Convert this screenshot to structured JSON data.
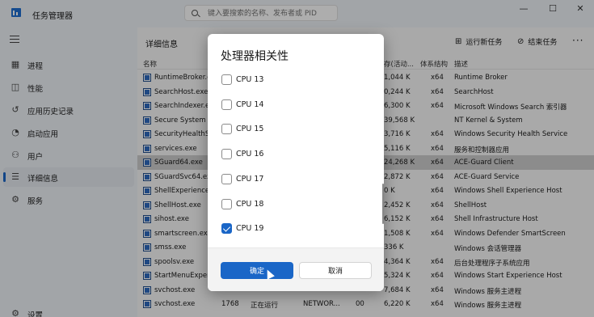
{
  "window": {
    "title": "任务管理器"
  },
  "search": {
    "placeholder": "键入要搜索的名称、发布者或 PID"
  },
  "controls": {
    "minimize": "—",
    "maximize": "☐",
    "close": "✕"
  },
  "sidebar": {
    "items": [
      {
        "label": "进程",
        "icon": "processes-icon"
      },
      {
        "label": "性能",
        "icon": "performance-icon"
      },
      {
        "label": "应用历史记录",
        "icon": "history-icon"
      },
      {
        "label": "启动应用",
        "icon": "startup-icon"
      },
      {
        "label": "用户",
        "icon": "users-icon"
      },
      {
        "label": "详细信息",
        "icon": "details-icon",
        "active": true
      },
      {
        "label": "服务",
        "icon": "services-icon"
      }
    ],
    "settings": "设置"
  },
  "toolbar": {
    "page_title": "详细信息",
    "run_new_task": "运行新任务",
    "end_task": "结束任务",
    "more": "···"
  },
  "table": {
    "columns": [
      "名称",
      "存(活动...",
      "体系结构",
      "描述"
    ],
    "rows": [
      {
        "name": "RuntimeBroker.e",
        "pid": "",
        "status": "",
        "user": "",
        "cpu": "",
        "mem": "1,044 K",
        "arch": "x64",
        "desc": "Runtime Broker"
      },
      {
        "name": "SearchHost.exe",
        "pid": "",
        "status": "",
        "user": "",
        "cpu": "",
        "mem": "0,244 K",
        "arch": "x64",
        "desc": "SearchHost"
      },
      {
        "name": "SearchIndexer.e",
        "pid": "",
        "status": "",
        "user": "",
        "cpu": "",
        "mem": "6,300 K",
        "arch": "x64",
        "desc": "Microsoft Windows Search 索引器"
      },
      {
        "name": "Secure System",
        "pid": "",
        "status": "",
        "user": "",
        "cpu": "",
        "mem": "39,568 K",
        "arch": "",
        "desc": "NT Kernel & System"
      },
      {
        "name": "SecurityHealthSe",
        "pid": "",
        "status": "",
        "user": "",
        "cpu": "",
        "mem": "3,716 K",
        "arch": "x64",
        "desc": "Windows Security Health Service"
      },
      {
        "name": "services.exe",
        "pid": "",
        "status": "",
        "user": "",
        "cpu": "",
        "mem": "5,116 K",
        "arch": "x64",
        "desc": "服务和控制器应用"
      },
      {
        "name": "SGuard64.exe",
        "pid": "",
        "status": "",
        "user": "",
        "cpu": "",
        "mem": "24,268 K",
        "arch": "x64",
        "desc": "ACE-Guard Client",
        "selected": true
      },
      {
        "name": "SGuardSvc64.exe",
        "pid": "",
        "status": "",
        "user": "",
        "cpu": "",
        "mem": "2,872 K",
        "arch": "x64",
        "desc": "ACE-Guard Service"
      },
      {
        "name": "ShellExperience",
        "pid": "",
        "status": "",
        "user": "",
        "cpu": "",
        "mem": "0 K",
        "arch": "x64",
        "desc": "Windows Shell Experience Host"
      },
      {
        "name": "ShellHost.exe",
        "pid": "",
        "status": "",
        "user": "",
        "cpu": "",
        "mem": "2,452 K",
        "arch": "x64",
        "desc": "ShellHost"
      },
      {
        "name": "sihost.exe",
        "pid": "",
        "status": "",
        "user": "",
        "cpu": "",
        "mem": "6,152 K",
        "arch": "x64",
        "desc": "Shell Infrastructure Host"
      },
      {
        "name": "smartscreen.exe",
        "pid": "",
        "status": "",
        "user": "",
        "cpu": "",
        "mem": "1,508 K",
        "arch": "x64",
        "desc": "Windows Defender SmartScreen"
      },
      {
        "name": "smss.exe",
        "pid": "",
        "status": "",
        "user": "",
        "cpu": "",
        "mem": "336 K",
        "arch": "",
        "desc": "Windows 会话管理器"
      },
      {
        "name": "spoolsv.exe",
        "pid": "",
        "status": "",
        "user": "",
        "cpu": "",
        "mem": "4,364 K",
        "arch": "x64",
        "desc": "后台处理程序子系统应用"
      },
      {
        "name": "StartMenuExper",
        "pid": "",
        "status": "",
        "user": "",
        "cpu": "",
        "mem": "5,324 K",
        "arch": "x64",
        "desc": "Windows Start Experience Host"
      },
      {
        "name": "svchost.exe",
        "pid": "",
        "status": "",
        "user": "",
        "cpu": "",
        "mem": "7,684 K",
        "arch": "x64",
        "desc": "Windows 服务主进程"
      },
      {
        "name": "svchost.exe",
        "pid": "1768",
        "status": "正在运行",
        "user": "NETWOR...",
        "cpu": "00",
        "mem": "6,220 K",
        "arch": "x64",
        "desc": "Windows 服务主进程"
      }
    ]
  },
  "dialog": {
    "title": "处理器相关性",
    "cpus": [
      {
        "label": "CPU 13",
        "checked": false
      },
      {
        "label": "CPU 14",
        "checked": false
      },
      {
        "label": "CPU 15",
        "checked": false
      },
      {
        "label": "CPU 16",
        "checked": false
      },
      {
        "label": "CPU 17",
        "checked": false
      },
      {
        "label": "CPU 18",
        "checked": false
      },
      {
        "label": "CPU 19",
        "checked": true
      }
    ],
    "ok": "确定",
    "cancel": "取消"
  },
  "colors": {
    "accent": "#1a66c7",
    "selected_row": "#cfcfcf"
  }
}
